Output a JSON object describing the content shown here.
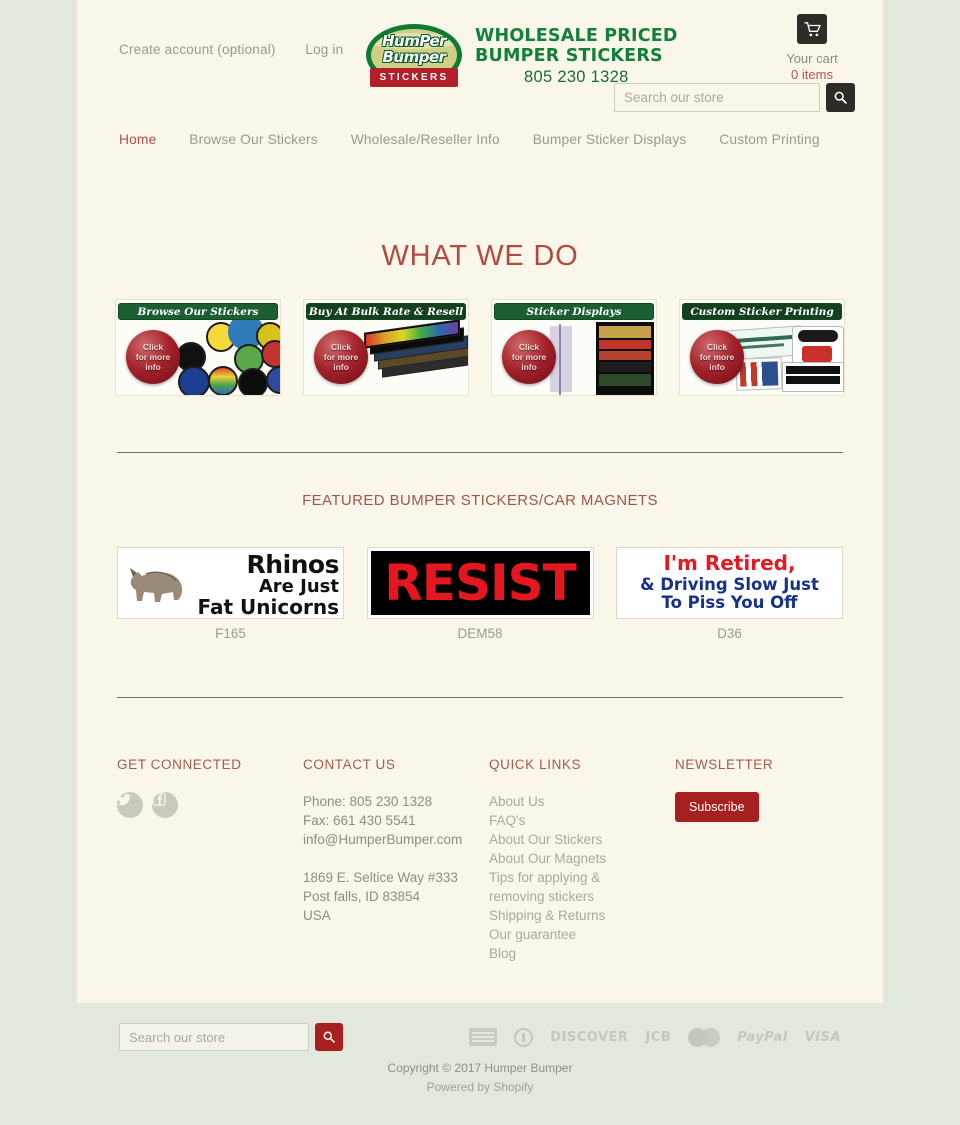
{
  "theme": {
    "page_bg": "#e3e8dd",
    "content_bg": "#faf6ea",
    "accent_red": "#b24a3f",
    "link_gray": "#9a9a8f",
    "brand_green": "#12803a",
    "button_dark": "#2f2b26",
    "button_red": "#a5201f"
  },
  "header": {
    "create_account": "Create account (optional)",
    "log_in": "Log in",
    "logo": {
      "word1": "HumPer",
      "word2": "Bumper",
      "ribbon": "STICKERS",
      "tagline_line1": "WHOLESALE PRICED",
      "tagline_line2": "BUMPER STICKERS",
      "phone": "805 230 1328"
    },
    "cart": {
      "icon": "shopping-cart-icon",
      "label": "Your cart",
      "count": "0 items"
    },
    "search": {
      "placeholder": "Search our store",
      "value": "",
      "icon": "search-icon"
    }
  },
  "nav": {
    "items": [
      {
        "label": "Home",
        "active": true
      },
      {
        "label": "Browse Our Stickers",
        "active": false
      },
      {
        "label": "Wholesale/Reseller Info",
        "active": false
      },
      {
        "label": "Bumper Sticker Displays",
        "active": false
      },
      {
        "label": "Custom Printing",
        "active": false
      }
    ]
  },
  "what_we_do": {
    "title": "WHAT WE DO",
    "tiles": [
      {
        "banner": "Browse Our Stickers",
        "orb_line1": "Click",
        "orb_line2": "for more",
        "orb_line3": "info"
      },
      {
        "banner": "Buy At Bulk Rate & Resell",
        "orb_line1": "Click",
        "orb_line2": "for more",
        "orb_line3": "info"
      },
      {
        "banner": "Sticker Displays",
        "orb_line1": "Click",
        "orb_line2": "for more",
        "orb_line3": "info"
      },
      {
        "banner": "Custom Sticker Printing",
        "orb_line1": "Click",
        "orb_line2": "for more",
        "orb_line3": "info"
      }
    ]
  },
  "featured": {
    "title": "FEATURED BUMPER STICKERS/CAR MAGNETS",
    "products": [
      {
        "code": "F165",
        "art_type": "rhino",
        "line1": "Rhinos",
        "line2": "Are Just",
        "line3": "Fat Unicorns"
      },
      {
        "code": "DEM58",
        "art_type": "resist",
        "line1": "RESIST"
      },
      {
        "code": "D36",
        "art_type": "retired",
        "line1": "I'm Retired,",
        "line2": "& Driving Slow Just",
        "line3": "To Piss You Off"
      }
    ]
  },
  "footer": {
    "get_connected": {
      "heading": "GET CONNECTED",
      "socials": [
        {
          "name": "twitter-icon"
        },
        {
          "name": "facebook-icon"
        }
      ]
    },
    "contact": {
      "heading": "CONTACT US",
      "phone": "Phone: 805 230 1328",
      "fax": "Fax: 661 430 5541",
      "email": "info@HumperBumper.com",
      "address1": "1869 E. Seltice Way #333",
      "address2": "Post falls, ID 83854",
      "address3": "USA"
    },
    "quick_links": {
      "heading": "QUICK LINKS",
      "items": [
        "About Us",
        "FAQ's",
        "About Our Stickers",
        "About Our Magnets",
        "Tips for applying & removing stickers",
        "Shipping & Returns",
        "Our guarantee",
        "Blog"
      ]
    },
    "newsletter": {
      "heading": "NEWSLETTER",
      "subscribe_label": "Subscribe"
    }
  },
  "bottom": {
    "search": {
      "placeholder": "Search our store",
      "value": "",
      "icon": "search-icon"
    },
    "payment_icons": [
      "american-express",
      "diners-club",
      "DISCOVER",
      "JCB",
      "mastercard",
      "PayPal",
      "VISA"
    ],
    "copyright": "Copyright © 2017 Humper Bumper",
    "powered_by": "Powered by Shopify"
  }
}
